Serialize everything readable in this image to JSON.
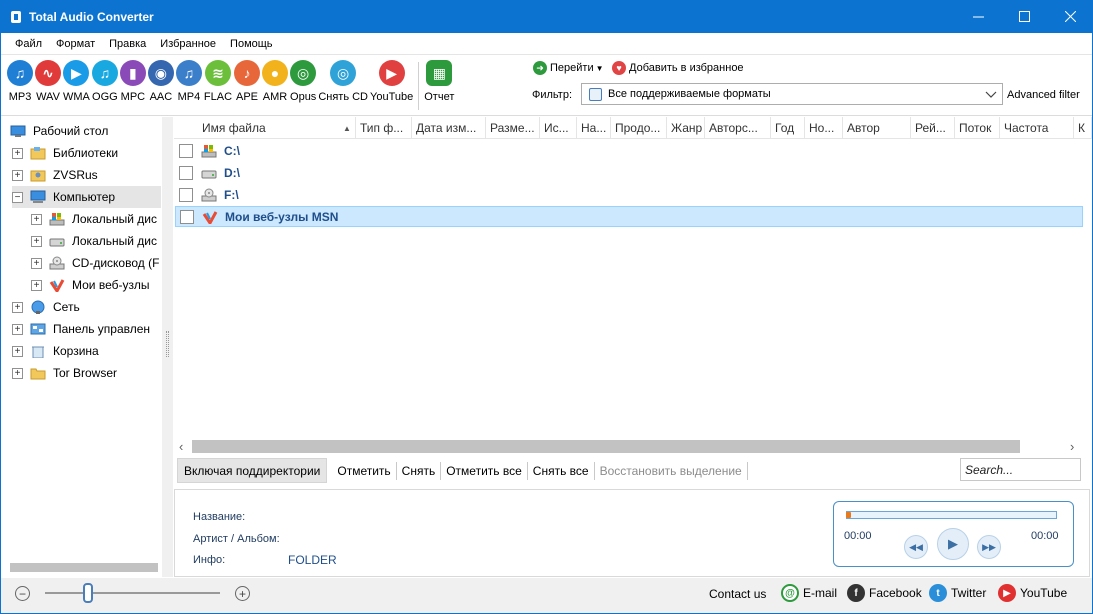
{
  "window": {
    "title": "Total Audio Converter",
    "accent_color": "#0c74d0"
  },
  "menu": [
    "Файл",
    "Формат",
    "Правка",
    "Избранное",
    "Помощь"
  ],
  "formats": [
    {
      "label": "MP3",
      "color": "#1f7fd4",
      "icon": "music-note-icon"
    },
    {
      "label": "WAV",
      "color": "#e03a3a",
      "icon": "waveform-icon"
    },
    {
      "label": "WMA",
      "color": "#1a9be8",
      "icon": "play-icon"
    },
    {
      "label": "OGG",
      "color": "#1aa8e0",
      "icon": "music-note-icon"
    },
    {
      "label": "MPC",
      "color": "#8a4bb8",
      "icon": "equalizer-icon"
    },
    {
      "label": "AAC",
      "color": "#3467b0",
      "icon": "speaker-icon"
    },
    {
      "label": "MP4",
      "color": "#3b7ec9",
      "icon": "music-note-icon"
    },
    {
      "label": "FLAC",
      "color": "#6bbf3a",
      "icon": "audio-waves-icon"
    },
    {
      "label": "APE",
      "color": "#e8673a",
      "icon": "guitar-icon"
    },
    {
      "label": "AMR",
      "color": "#f2b21b",
      "icon": "microphone-icon"
    },
    {
      "label": "Opus",
      "color": "#2e9a3e",
      "icon": "opus-icon"
    },
    {
      "label": "Снять CD",
      "color": "#2fa3d8",
      "icon": "cd-icon"
    },
    {
      "label": "YouTube",
      "color": "#e04040",
      "icon": "youtube-icon"
    }
  ],
  "report": {
    "label": "Отчет",
    "color": "#2e9a3e"
  },
  "goto": {
    "label": "Перейти",
    "color": "#2e9a3e"
  },
  "favorites": {
    "label": "Добавить в избранное",
    "color": "#e04444"
  },
  "filter": {
    "label": "Фильтр:",
    "value": "Все поддерживаемые форматы",
    "advanced_label": "Advanced filter"
  },
  "tree": [
    {
      "label": "Рабочий стол",
      "level": 0,
      "expander": "",
      "icon": "desktop-icon"
    },
    {
      "label": "Библиотеки",
      "level": 0,
      "expander": "+",
      "icon": "libraries-icon"
    },
    {
      "label": "ZVSRus",
      "level": 0,
      "expander": "+",
      "icon": "user-folder-icon"
    },
    {
      "label": "Компьютер",
      "level": 0,
      "expander": "−",
      "icon": "computer-icon",
      "selected": true
    },
    {
      "label": "Локальный дис",
      "level": 1,
      "expander": "+",
      "icon": "windows-drive-icon"
    },
    {
      "label": "Локальный дис",
      "level": 1,
      "expander": "+",
      "icon": "hard-drive-icon"
    },
    {
      "label": "CD-дисковод (F",
      "level": 1,
      "expander": "+",
      "icon": "cd-drive-icon"
    },
    {
      "label": "Мои веб-узлы",
      "level": 1,
      "expander": "+",
      "icon": "msn-icon"
    },
    {
      "label": "Сеть",
      "level": 0,
      "expander": "+",
      "icon": "network-icon"
    },
    {
      "label": "Панель управлен",
      "level": 0,
      "expander": "+",
      "icon": "control-panel-icon"
    },
    {
      "label": "Корзина",
      "level": 0,
      "expander": "+",
      "icon": "recycle-bin-icon"
    },
    {
      "label": "Tor Browser",
      "level": 0,
      "expander": "+",
      "icon": "folder-icon"
    }
  ],
  "columns": [
    "Имя файла",
    "Тип ф...",
    "Дата изм...",
    "Разме...",
    "Ис...",
    "На...",
    "Продо...",
    "Жанр",
    "Авторс...",
    "Год",
    "Но...",
    "Автор",
    "Рей...",
    "Поток",
    "Частота",
    "К"
  ],
  "files": [
    {
      "name": "C:\\",
      "icon": "windows-drive-icon"
    },
    {
      "name": "D:\\",
      "icon": "hard-drive-icon"
    },
    {
      "name": "F:\\",
      "icon": "cd-drive-icon"
    },
    {
      "name": "Мои веб-узлы MSN",
      "icon": "msn-icon",
      "selected": true
    }
  ],
  "actions": {
    "include_subdirs": "Включая поддиректории",
    "check": "Отметить",
    "uncheck": "Снять",
    "check_all": "Отметить все",
    "uncheck_all": "Снять все",
    "restore_selection": "Восстановить выделение",
    "search_placeholder": "Search..."
  },
  "info": {
    "name_label": "Название:",
    "artist_label": "Артист / Альбом:",
    "info_label": "Инфо:",
    "info_value": "FOLDER"
  },
  "player": {
    "time_start": "00:00",
    "time_end": "00:00",
    "progress": 0.0
  },
  "status": {
    "contact_label": "Contact us",
    "links": [
      {
        "label": "E-mail",
        "color": "#2e9a3e",
        "glyph": "@",
        "icon": "email-icon"
      },
      {
        "label": "Facebook",
        "color": "#333333",
        "glyph": "f",
        "icon": "facebook-icon"
      },
      {
        "label": "Twitter",
        "color": "#2a8fd8",
        "glyph": "t",
        "icon": "twitter-icon"
      },
      {
        "label": "YouTube",
        "color": "#e03030",
        "glyph": "▶",
        "icon": "youtube-icon"
      }
    ],
    "zoom_minus": "−",
    "zoom_plus": "+"
  }
}
